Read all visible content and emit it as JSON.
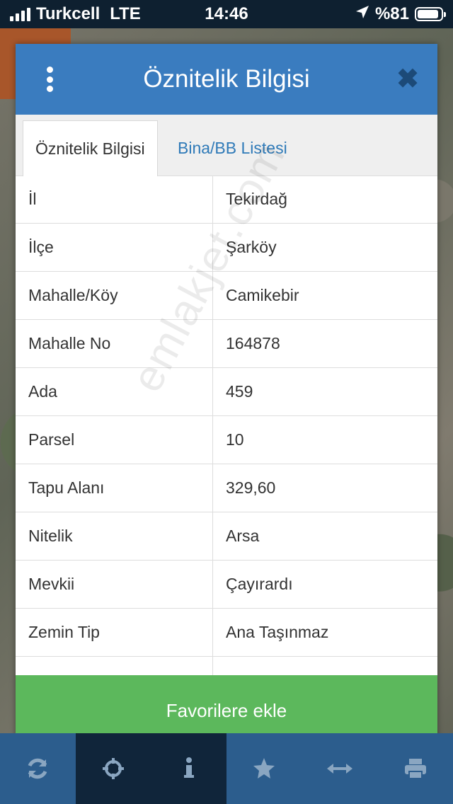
{
  "status_bar": {
    "carrier": "Turkcell",
    "network": "LTE",
    "time": "14:46",
    "battery": "%81"
  },
  "dialog": {
    "title": "Öznitelik Bilgisi",
    "close_icon": "close-icon",
    "menu_icon": "kebab-menu-icon",
    "tabs": [
      {
        "label": "Öznitelik Bilgisi",
        "active": true
      },
      {
        "label": "Bina/BB Listesi",
        "active": false
      }
    ],
    "rows": [
      {
        "key": "İl",
        "value": "Tekirdağ"
      },
      {
        "key": "İlçe",
        "value": "Şarköy"
      },
      {
        "key": "Mahalle/Köy",
        "value": "Camikebir"
      },
      {
        "key": "Mahalle No",
        "value": "164878"
      },
      {
        "key": "Ada",
        "value": "459"
      },
      {
        "key": "Parsel",
        "value": "10"
      },
      {
        "key": "Tapu Alanı",
        "value": "329,60"
      },
      {
        "key": "Nitelik",
        "value": "Arsa"
      },
      {
        "key": "Mevkii",
        "value": "Çayırardı"
      },
      {
        "key": "Zemin Tip",
        "value": "Ana Taşınmaz"
      }
    ],
    "watermark": "emlakjet.com",
    "favorite_button": "Favorilere ekle"
  },
  "toolbar": {
    "icons": [
      "refresh-icon",
      "locate-icon",
      "info-icon",
      "star-icon",
      "measure-icon",
      "print-icon"
    ]
  },
  "colors": {
    "header": "#3a7cbf",
    "tab_link": "#2f7ab8",
    "button": "#5cb85c",
    "toolbar": "#2c5d8d",
    "toolbar_active": "#10253a"
  }
}
